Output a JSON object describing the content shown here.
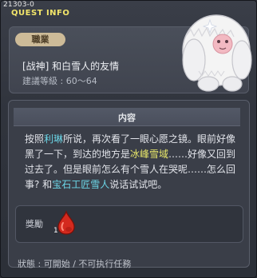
{
  "window": {
    "quest_id": "21303-0",
    "title": "QUEST INFO"
  },
  "header": {
    "badge": "職業",
    "quest_title": "[战神] 和白雪人的友情",
    "required_level": "建議等級 : 60～64",
    "npc_icon": "white-yeti-icon"
  },
  "content": {
    "header": "内容",
    "description": {
      "p1": "按照",
      "name1": "利琳",
      "p2": "所说，再次看了一眼心愿之镜。眼前好像黑了一下，到达的地方是",
      "place": "冰峰雪域",
      "p3": "……好像又回到过去了。但是眼前怎么有个雪人在哭呢……怎么回事? 和",
      "name2": "宝石工匠雪人",
      "p4": "说话试试吧。"
    }
  },
  "reward": {
    "label": "獎勵",
    "item_icon": "red-potion-icon",
    "quantity": "1"
  },
  "status": "狀態 : 可開始 / 不可执行任務",
  "colors": {
    "title_yellow": "#f2e56a",
    "highlight_cyan": "#6cd7e8",
    "highlight_yellow": "#e7e66a",
    "badge_bg": "#cdbb98"
  }
}
